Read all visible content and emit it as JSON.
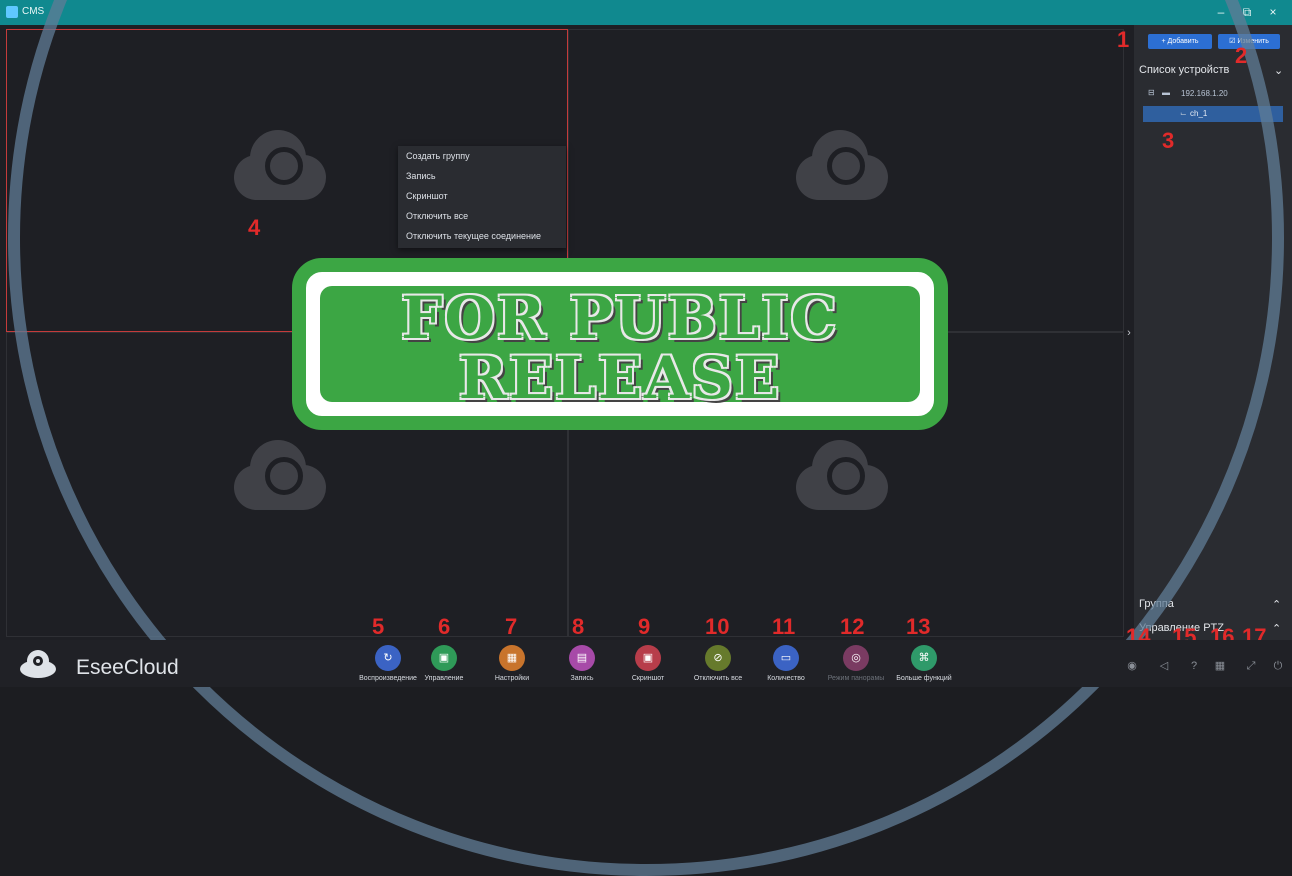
{
  "window": {
    "title": "CMS",
    "minimize": "–",
    "restore": "⧉",
    "close": "×"
  },
  "toolbar_right": {
    "add_label": "+ Добавить",
    "edit_label": "☑ Изменить"
  },
  "sidebar": {
    "device_list_title": "Список устройств",
    "tree": [
      {
        "label": "192.168.1.20"
      },
      {
        "label": "ch_1"
      }
    ],
    "group_label": "Группа",
    "ptz_label": "Управление PTZ"
  },
  "context_menu": {
    "items": [
      "Создать группу",
      "Запись",
      "Скриншот",
      "Отключить все",
      "Отключить текущее соединение"
    ]
  },
  "stamp": {
    "line1": "FOR PUBLIC",
    "line2": "RELEASE",
    "color": "#3ca644"
  },
  "annotations": [
    "1",
    "2",
    "3",
    "4",
    "5",
    "6",
    "7",
    "8",
    "9",
    "10",
    "11",
    "12",
    "13",
    "14",
    "15",
    "16",
    "17"
  ],
  "brand": {
    "name": "EseeCloud"
  },
  "bottom_tools": [
    {
      "label": "Воспроизведение",
      "icon": "playback-icon",
      "color": "#3b63c4"
    },
    {
      "label": "Управление",
      "icon": "device-manage-icon",
      "color": "#2f9a58"
    },
    {
      "label": "Настройки",
      "icon": "settings-icon",
      "color": "#c8742c"
    },
    {
      "label": "Запись",
      "icon": "record-icon",
      "color": "#a74aa8"
    },
    {
      "label": "Скриншот",
      "icon": "screenshot-icon",
      "color": "#b73d4a"
    },
    {
      "label": "Отключить все",
      "icon": "disconnect-all-icon",
      "color": "#667a2c"
    },
    {
      "label": "Количество",
      "icon": "layout-count-icon",
      "color": "#3b63c4"
    },
    {
      "label": "Режим панорамы",
      "icon": "panorama-icon",
      "color": "#7a3b62"
    },
    {
      "label": "Больше функций",
      "icon": "more-functions-icon",
      "color": "#2f9a6a"
    }
  ],
  "status_icons": [
    "ws-icon",
    "volume-icon",
    "help-icon",
    "layout-icon",
    "fullscreen-icon",
    "power-icon"
  ]
}
